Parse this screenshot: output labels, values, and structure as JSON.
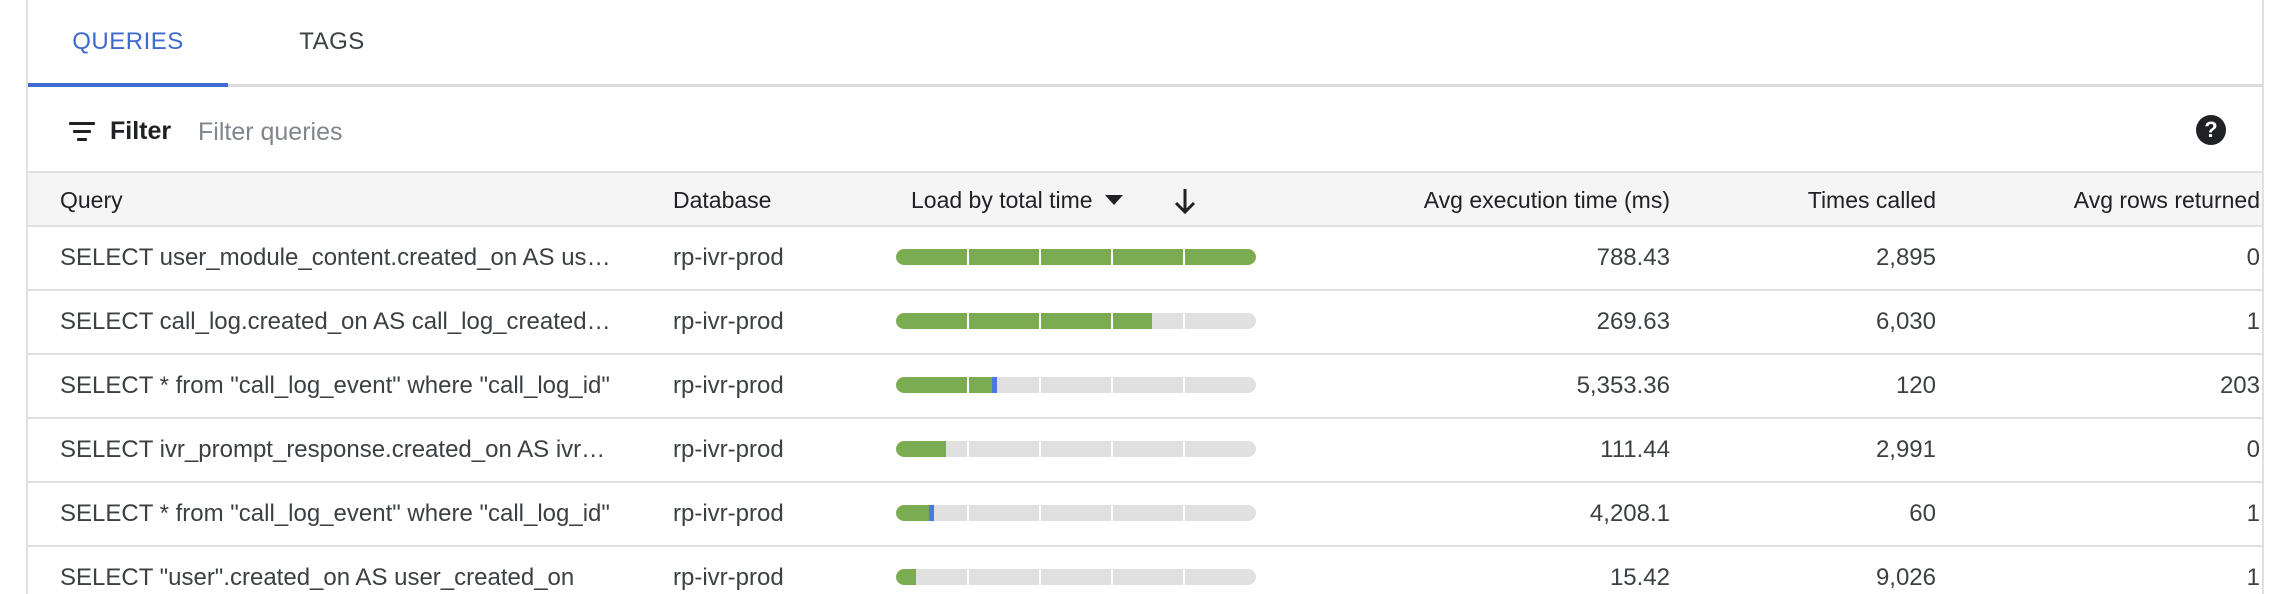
{
  "tabs": [
    {
      "label": "QUERIES",
      "active": true
    },
    {
      "label": "TAGS",
      "active": false
    }
  ],
  "filter": {
    "label": "Filter",
    "placeholder": "Filter queries",
    "value": "",
    "help_icon": "?"
  },
  "columns": {
    "query": "Query",
    "database": "Database",
    "load": "Load by total time",
    "avg_exec": "Avg execution time (ms)",
    "times_called": "Times called",
    "avg_rows": "Avg rows returned"
  },
  "colors": {
    "accent": "#3e6ad0",
    "load_green": "#7cac51",
    "load_blue": "#4a79e0",
    "bar_bg": "#e0e0e0"
  },
  "rows": [
    {
      "query": "SELECT user_module_content.created_on AS user_module_content_created_on",
      "database": "rp-ivr-prod",
      "load": 1.0,
      "load_blue": 0,
      "avg_exec": "788.43",
      "times_called": "2,895",
      "avg_rows": "0"
    },
    {
      "query": "SELECT call_log.created_on AS call_log_created_on",
      "database": "rp-ivr-prod",
      "load": 0.71,
      "load_blue": 0,
      "avg_exec": "269.63",
      "times_called": "6,030",
      "avg_rows": "1"
    },
    {
      "query": "SELECT * from \"call_log_event\" where \"call_log_id\"",
      "database": "rp-ivr-prod",
      "load": 0.28,
      "load_blue": 0.015,
      "avg_exec": "5,353.36",
      "times_called": "120",
      "avg_rows": "203"
    },
    {
      "query": "SELECT ivr_prompt_response.created_on AS ivr_prompt_response_created_on",
      "database": "rp-ivr-prod",
      "load": 0.14,
      "load_blue": 0,
      "avg_exec": "111.44",
      "times_called": "2,991",
      "avg_rows": "0"
    },
    {
      "query": "SELECT * from \"call_log_event\" where \"call_log_id\"",
      "database": "rp-ivr-prod",
      "load": 0.105,
      "load_blue": 0.008,
      "avg_exec": "4,208.1",
      "times_called": "60",
      "avg_rows": "1"
    },
    {
      "query": "SELECT \"user\".created_on AS user_created_on",
      "database": "rp-ivr-prod",
      "load": 0.055,
      "load_blue": 0,
      "avg_exec": "15.42",
      "times_called": "9,026",
      "avg_rows": "1"
    }
  ]
}
